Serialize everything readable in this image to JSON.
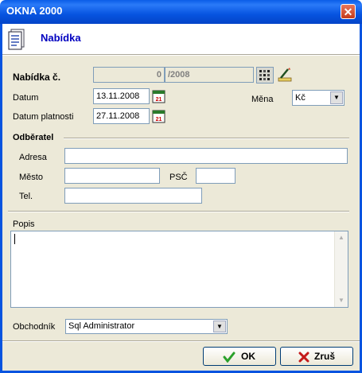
{
  "window": {
    "title": "OKNA 2000",
    "close_glyph": "✕"
  },
  "header": {
    "title": "Nabídka",
    "icon": "document-icon"
  },
  "form": {
    "offer_label": "Nabídka č.",
    "offer_number": "0",
    "offer_suffix": "/2008",
    "date_label": "Datum",
    "date_value": "13.11.2008",
    "validity_label": "Datum platnosti",
    "validity_value": "27.11.2008",
    "currency_label": "Měna",
    "currency_value": "Kč",
    "customer_section": "Odběratel",
    "address_label": "Adresa",
    "address_value": "",
    "city_label": "Město",
    "city_value": "",
    "zip_label": "PSČ",
    "zip_value": "",
    "phone_label": "Tel.",
    "phone_value": "",
    "description_label": "Popis",
    "description_value": "",
    "dealer_label": "Obchodník",
    "dealer_value": "Sql Administrator",
    "calendar_day": "21"
  },
  "buttons": {
    "ok": "OK",
    "cancel": "Zruš"
  },
  "colors": {
    "title_bar": "#0754e0",
    "header_text": "#0000c0",
    "dialog_bg": "#ece9d8",
    "ok_green": "#2aa02a",
    "cancel_red": "#c41a1a"
  }
}
